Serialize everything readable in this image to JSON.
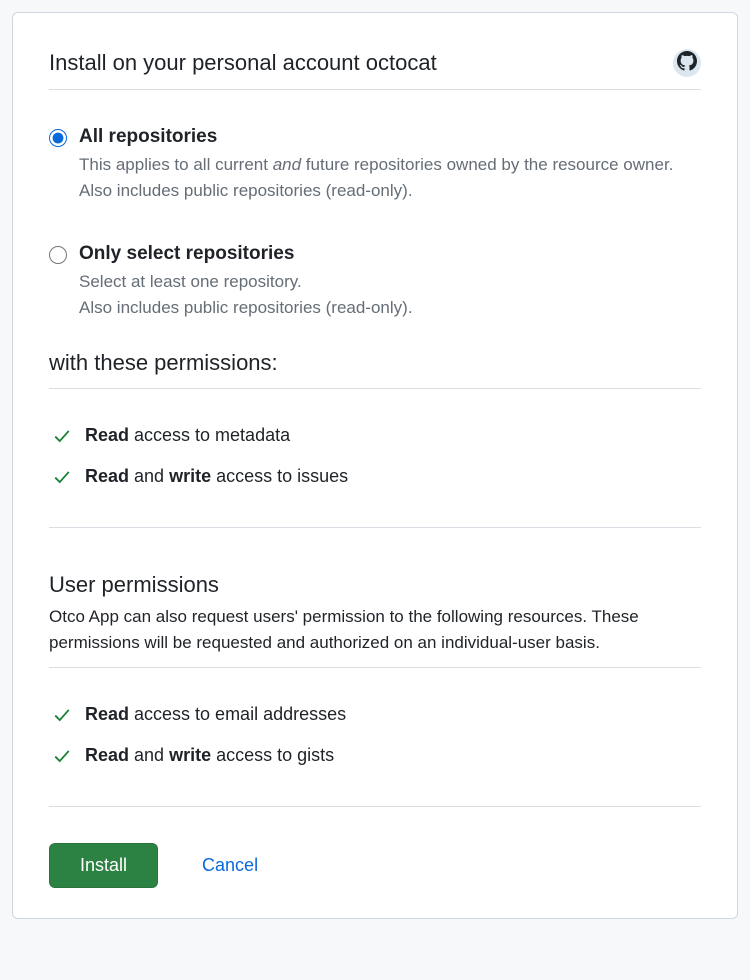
{
  "header": {
    "title": "Install on your personal account octocat"
  },
  "repo_scope": {
    "all": {
      "label": "All repositories",
      "desc_pre": "This applies to all current ",
      "desc_em": "and",
      "desc_post": " future repositories owned by the resource owner.",
      "desc_line2": "Also includes public repositories (read-only)."
    },
    "select": {
      "label": "Only select repositories",
      "desc_line1": "Select at least one repository.",
      "desc_line2": "Also includes public repositories (read-only)."
    }
  },
  "permissions": {
    "heading": "with these permissions:",
    "items": [
      {
        "bold1": "Read",
        "rest": " access to metadata"
      },
      {
        "bold1": "Read",
        "mid": " and ",
        "bold2": "write",
        "rest": " access to issues"
      }
    ]
  },
  "user_permissions": {
    "heading": "User permissions",
    "subtext": "Otco App can also request users' permission to the following resources. These permissions will be requested and authorized on an individual-user basis.",
    "items": [
      {
        "bold1": "Read",
        "rest": " access to email addresses"
      },
      {
        "bold1": "Read",
        "mid": " and ",
        "bold2": "write",
        "rest": " access to gists"
      }
    ]
  },
  "actions": {
    "install": "Install",
    "cancel": "Cancel"
  }
}
